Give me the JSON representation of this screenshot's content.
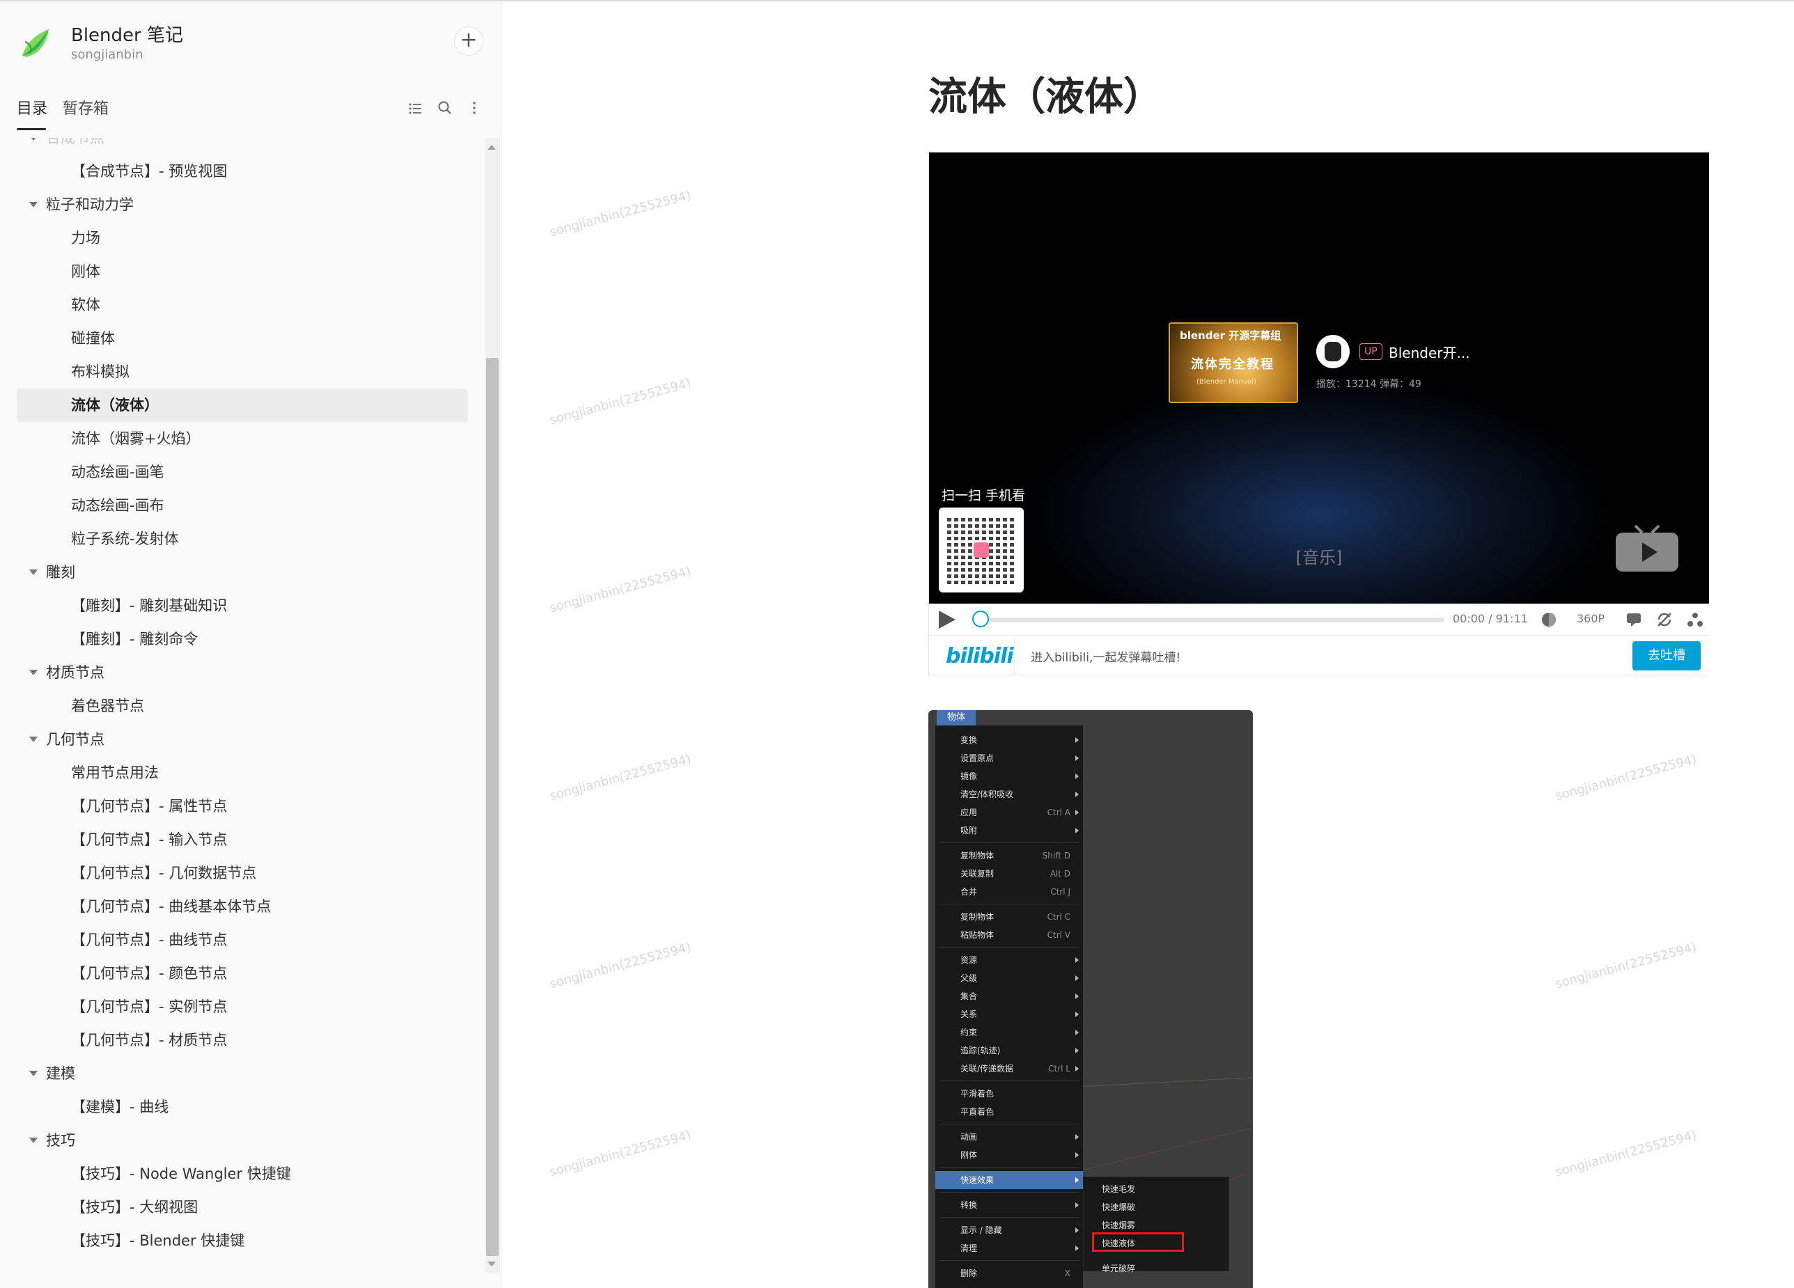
{
  "book": {
    "title": "Blender 笔记",
    "owner": "songjianbin"
  },
  "tabs": [
    {
      "label": "目录"
    },
    {
      "label": "暂存箱"
    }
  ],
  "tree": [
    {
      "label": "合成节点",
      "level": 1,
      "faded": true,
      "caret": true
    },
    {
      "label": "【合成节点】- 预览视图",
      "level": 2
    },
    {
      "label": "粒子和动力学",
      "level": 1,
      "caret": true
    },
    {
      "label": "力场",
      "level": 2
    },
    {
      "label": "刚体",
      "level": 2
    },
    {
      "label": "软体",
      "level": 2
    },
    {
      "label": "碰撞体",
      "level": 2
    },
    {
      "label": "布料模拟",
      "level": 2
    },
    {
      "label": "流体（液体）",
      "level": 2,
      "selected": true
    },
    {
      "label": "流体（烟雾+火焰）",
      "level": 2
    },
    {
      "label": "动态绘画-画笔",
      "level": 2
    },
    {
      "label": "动态绘画-画布",
      "level": 2
    },
    {
      "label": "粒子系统-发射体",
      "level": 2
    },
    {
      "label": "雕刻",
      "level": 1,
      "caret": true
    },
    {
      "label": "【雕刻】- 雕刻基础知识",
      "level": 2
    },
    {
      "label": "【雕刻】- 雕刻命令",
      "level": 2
    },
    {
      "label": "材质节点",
      "level": 1,
      "caret": true
    },
    {
      "label": "着色器节点",
      "level": 2
    },
    {
      "label": "几何节点",
      "level": 1,
      "caret": true
    },
    {
      "label": "常用节点用法",
      "level": 2
    },
    {
      "label": "【几何节点】- 属性节点",
      "level": 2
    },
    {
      "label": "【几何节点】- 输入节点",
      "level": 2
    },
    {
      "label": "【几何节点】- 几何数据节点",
      "level": 2
    },
    {
      "label": "【几何节点】- 曲线基本体节点",
      "level": 2
    },
    {
      "label": "【几何节点】- 曲线节点",
      "level": 2
    },
    {
      "label": "【几何节点】- 颜色节点",
      "level": 2
    },
    {
      "label": "【几何节点】- 实例节点",
      "level": 2
    },
    {
      "label": "【几何节点】- 材质节点",
      "level": 2
    },
    {
      "label": "建模",
      "level": 1,
      "caret": true
    },
    {
      "label": "【建模】- 曲线",
      "level": 2
    },
    {
      "label": "技巧",
      "level": 1,
      "caret": true
    },
    {
      "label": "【技巧】- Node Wangler 快捷键",
      "level": 2
    },
    {
      "label": "【技巧】- 大纲视图",
      "level": 2
    },
    {
      "label": "【技巧】- Blender 快捷键",
      "level": 2
    }
  ],
  "watermark": "songjianbin(22552594)",
  "doc": {
    "title": "流体（液体）"
  },
  "video": {
    "thumb_brand": "blender 开源字幕组",
    "thumb_title": "流体完全教程",
    "thumb_sub": "(Blender Manual)",
    "up_badge": "UP",
    "up_name": "Blender开...",
    "stats": "播放：13214    弹幕：49",
    "scan_label": "扫一扫 手机看",
    "subtitle": "[音乐]",
    "time": "00:00 / 91:11",
    "quality": "360P",
    "bili_logo": "bilibili",
    "danmaku_hint": "进入bilibili,一起发弹幕吐槽!",
    "tucao_button": "去吐槽",
    "progress": 0
  },
  "blender": {
    "header": "物体",
    "groups": [
      [
        {
          "t": "变换",
          "arr": true
        },
        {
          "t": "设置原点",
          "arr": true
        },
        {
          "t": "镜像",
          "arr": true
        },
        {
          "t": "清空/体积吸收",
          "arr": true
        },
        {
          "t": "应用",
          "k": "Ctrl A",
          "arr": true
        },
        {
          "t": "吸附",
          "arr": true
        }
      ],
      [
        {
          "t": "复制物体",
          "k": "Shift D"
        },
        {
          "t": "关联复制",
          "k": "Alt D"
        },
        {
          "t": "合并",
          "k": "Ctrl J"
        }
      ],
      [
        {
          "t": "复制物体",
          "k": "Ctrl C"
        },
        {
          "t": "粘贴物体",
          "k": "Ctrl V"
        }
      ],
      [
        {
          "t": "资源",
          "arr": true
        },
        {
          "t": "父级",
          "arr": true
        },
        {
          "t": "集合",
          "arr": true
        },
        {
          "t": "关系",
          "arr": true
        },
        {
          "t": "约束",
          "arr": true
        },
        {
          "t": "追踪(轨迹)",
          "arr": true
        },
        {
          "t": "关联/传递数据",
          "k": "Ctrl L",
          "arr": true
        }
      ],
      [
        {
          "t": "平滑着色"
        },
        {
          "t": "平直着色"
        }
      ],
      [
        {
          "t": "动画",
          "arr": true
        },
        {
          "t": "刚体",
          "arr": true
        }
      ],
      [
        {
          "t": "快速效果",
          "arr": true,
          "hl": true
        }
      ],
      [
        {
          "t": "转换",
          "arr": true
        }
      ],
      [
        {
          "t": "显示 / 隐藏",
          "arr": true
        },
        {
          "t": "清理",
          "arr": true
        }
      ],
      [
        {
          "t": "删除",
          "k": "X"
        }
      ]
    ],
    "submenu": [
      {
        "t": "快速毛发"
      },
      {
        "t": "快速爆破"
      },
      {
        "t": "快速烟雾"
      },
      {
        "t": "快速液体"
      },
      {
        "t": "单元破碎"
      }
    ]
  }
}
